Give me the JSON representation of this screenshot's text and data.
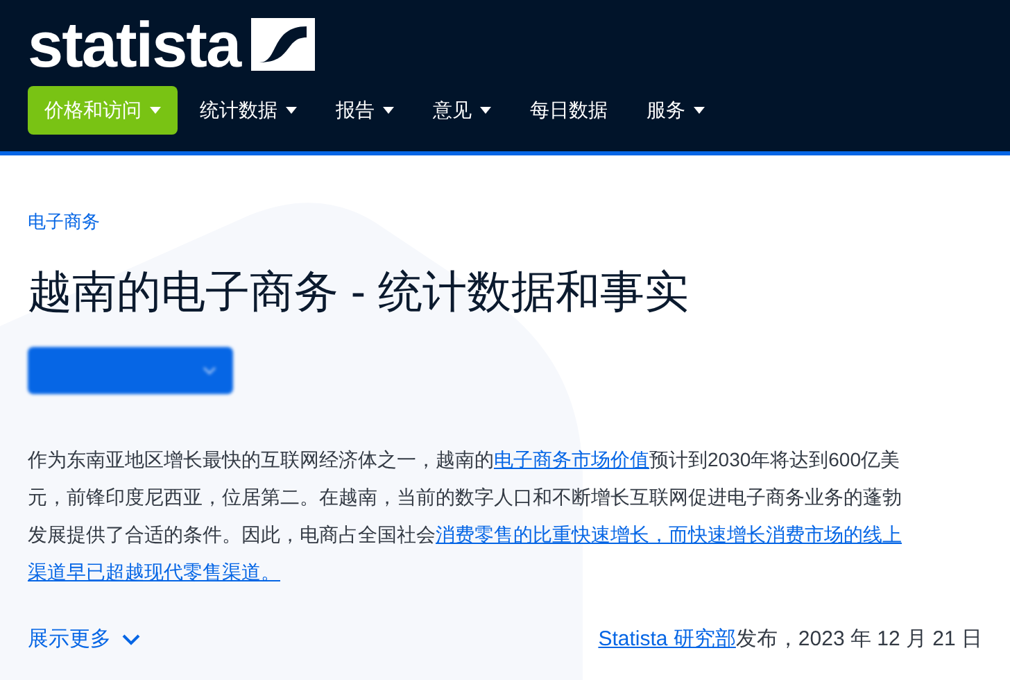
{
  "header": {
    "logo": "statista",
    "nav": [
      {
        "label": "价格和访问",
        "selected": true,
        "dropdown": true
      },
      {
        "label": "统计数据",
        "selected": false,
        "dropdown": true
      },
      {
        "label": "报告",
        "selected": false,
        "dropdown": true
      },
      {
        "label": "意见",
        "selected": false,
        "dropdown": true
      },
      {
        "label": "每日数据",
        "selected": false,
        "dropdown": false
      },
      {
        "label": "服务",
        "selected": false,
        "dropdown": true
      }
    ]
  },
  "breadcrumb": "电子商务",
  "title": "越南的电子商务 - 统计数据和事实",
  "intro_lines": [
    [
      {
        "kind": "text",
        "text": "作为东南亚地区增长最快的互联网经济体之一，越南的"
      },
      {
        "kind": "link",
        "text": "电子商务市场价值"
      },
      {
        "kind": "text",
        "text": "预计到2030年将达到600亿美"
      }
    ],
    [
      {
        "kind": "text",
        "text": "元，前锋印度尼西亚，位居第二。在越南，当前的数字人口和不断增长互联网促进电子商务业务的蓬勃"
      }
    ],
    [
      {
        "kind": "text",
        "text": "发展提供了合适的条件。因此，电商占全国社会"
      },
      {
        "kind": "link",
        "text": "消费零售的比重快速增长，而快速增长消费市场的线上"
      }
    ],
    [
      {
        "kind": "link",
        "text": "渠道早已超越现代零售渠道。"
      }
    ]
  ],
  "show_more": "展示更多",
  "published": {
    "author": "Statista 研究部",
    "text": "发布，2023 年 12 月 21 日"
  }
}
